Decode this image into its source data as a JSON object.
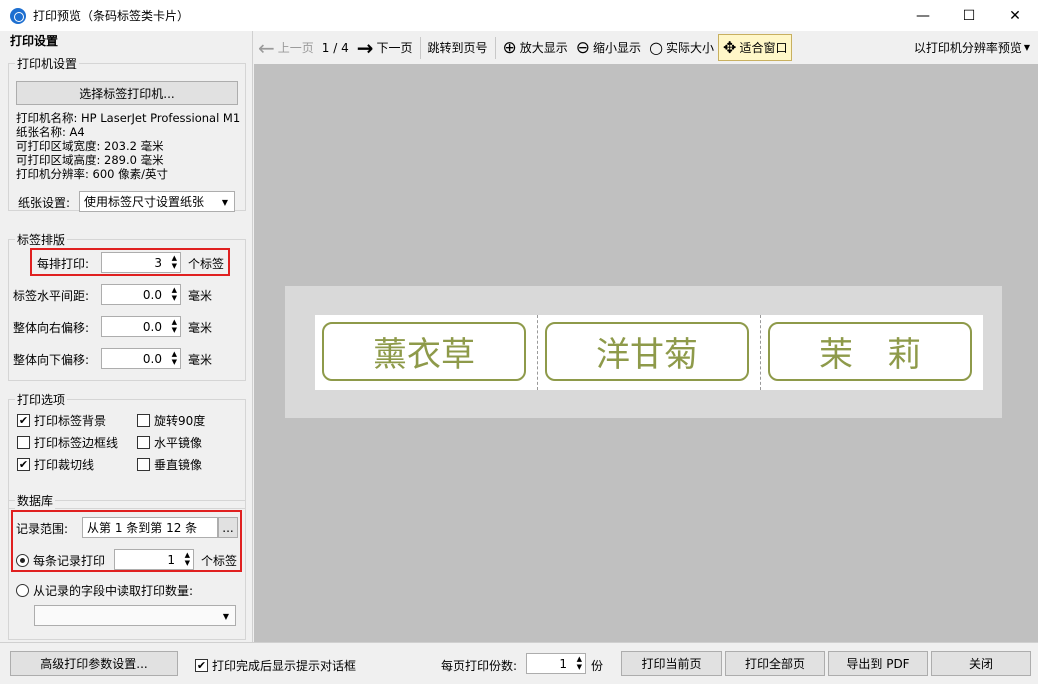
{
  "window": {
    "title": "打印预览（条码标签类卡片）",
    "minimize": "—",
    "maximize": "☐",
    "close": "✕"
  },
  "left": {
    "header": "打印设置",
    "printer_group": {
      "title": "打印机设置",
      "select_button": "选择标签打印机...",
      "info": [
        "打印机名称: HP LaserJet Professional M1",
        "纸张名称: A4",
        "可打印区域宽度: 203.2 毫米",
        "可打印区域高度: 289.0 毫米",
        "打印机分辨率: 600 像素/英寸"
      ],
      "paper_label": "纸张设置:",
      "paper_value": "使用标签尺寸设置纸张"
    },
    "layout_group": {
      "title": "标签排版",
      "per_row_label": "每排打印:",
      "per_row_value": "3",
      "per_row_unit": "个标签",
      "h_gap_label": "标签水平间距:",
      "h_gap_value": "0.0",
      "h_gap_unit": "毫米",
      "right_offset_label": "整体向右偏移:",
      "right_offset_value": "0.0",
      "right_offset_unit": "毫米",
      "down_offset_label": "整体向下偏移:",
      "down_offset_value": "0.0",
      "down_offset_unit": "毫米"
    },
    "options_group": {
      "title": "打印选项",
      "print_bg": "打印标签背景",
      "rotate90": "旋转90度",
      "print_border": "打印标签边框线",
      "h_mirror": "水平镜像",
      "print_cutline": "打印裁切线",
      "v_mirror": "垂直镜像",
      "check_mark": "✔"
    },
    "db_group": {
      "title": "数据库",
      "range_label": "记录范围:",
      "range_value": "从第 1 条到第 12 条",
      "range_button": "...",
      "each_record_label": "每条记录打印",
      "each_record_value": "1",
      "each_record_unit": "个标签",
      "from_field_label": "从记录的字段中读取打印数量:"
    }
  },
  "toolbar": {
    "prev": "上一页",
    "page_indicator": "1 / 4",
    "next": "下一页",
    "jump": "跳转到页号",
    "zoom_in": "放大显示",
    "zoom_out": "缩小显示",
    "actual_size": "实际大小",
    "fit_window": "适合窗口",
    "resolution_preview": "以打印机分辨率预览"
  },
  "preview": {
    "labels": [
      "薰衣草",
      "洋甘菊",
      "茉　莉"
    ],
    "label_color": "#8e9a4a"
  },
  "bottom": {
    "advanced_button": "高级打印参数设置...",
    "show_dialog_label": "打印完成后显示提示对话框",
    "copies_label": "每页打印份数:",
    "copies_value": "1",
    "copies_unit": "份",
    "print_current": "打印当前页",
    "print_all": "打印全部页",
    "export_pdf": "导出到 PDF",
    "close": "关闭"
  }
}
